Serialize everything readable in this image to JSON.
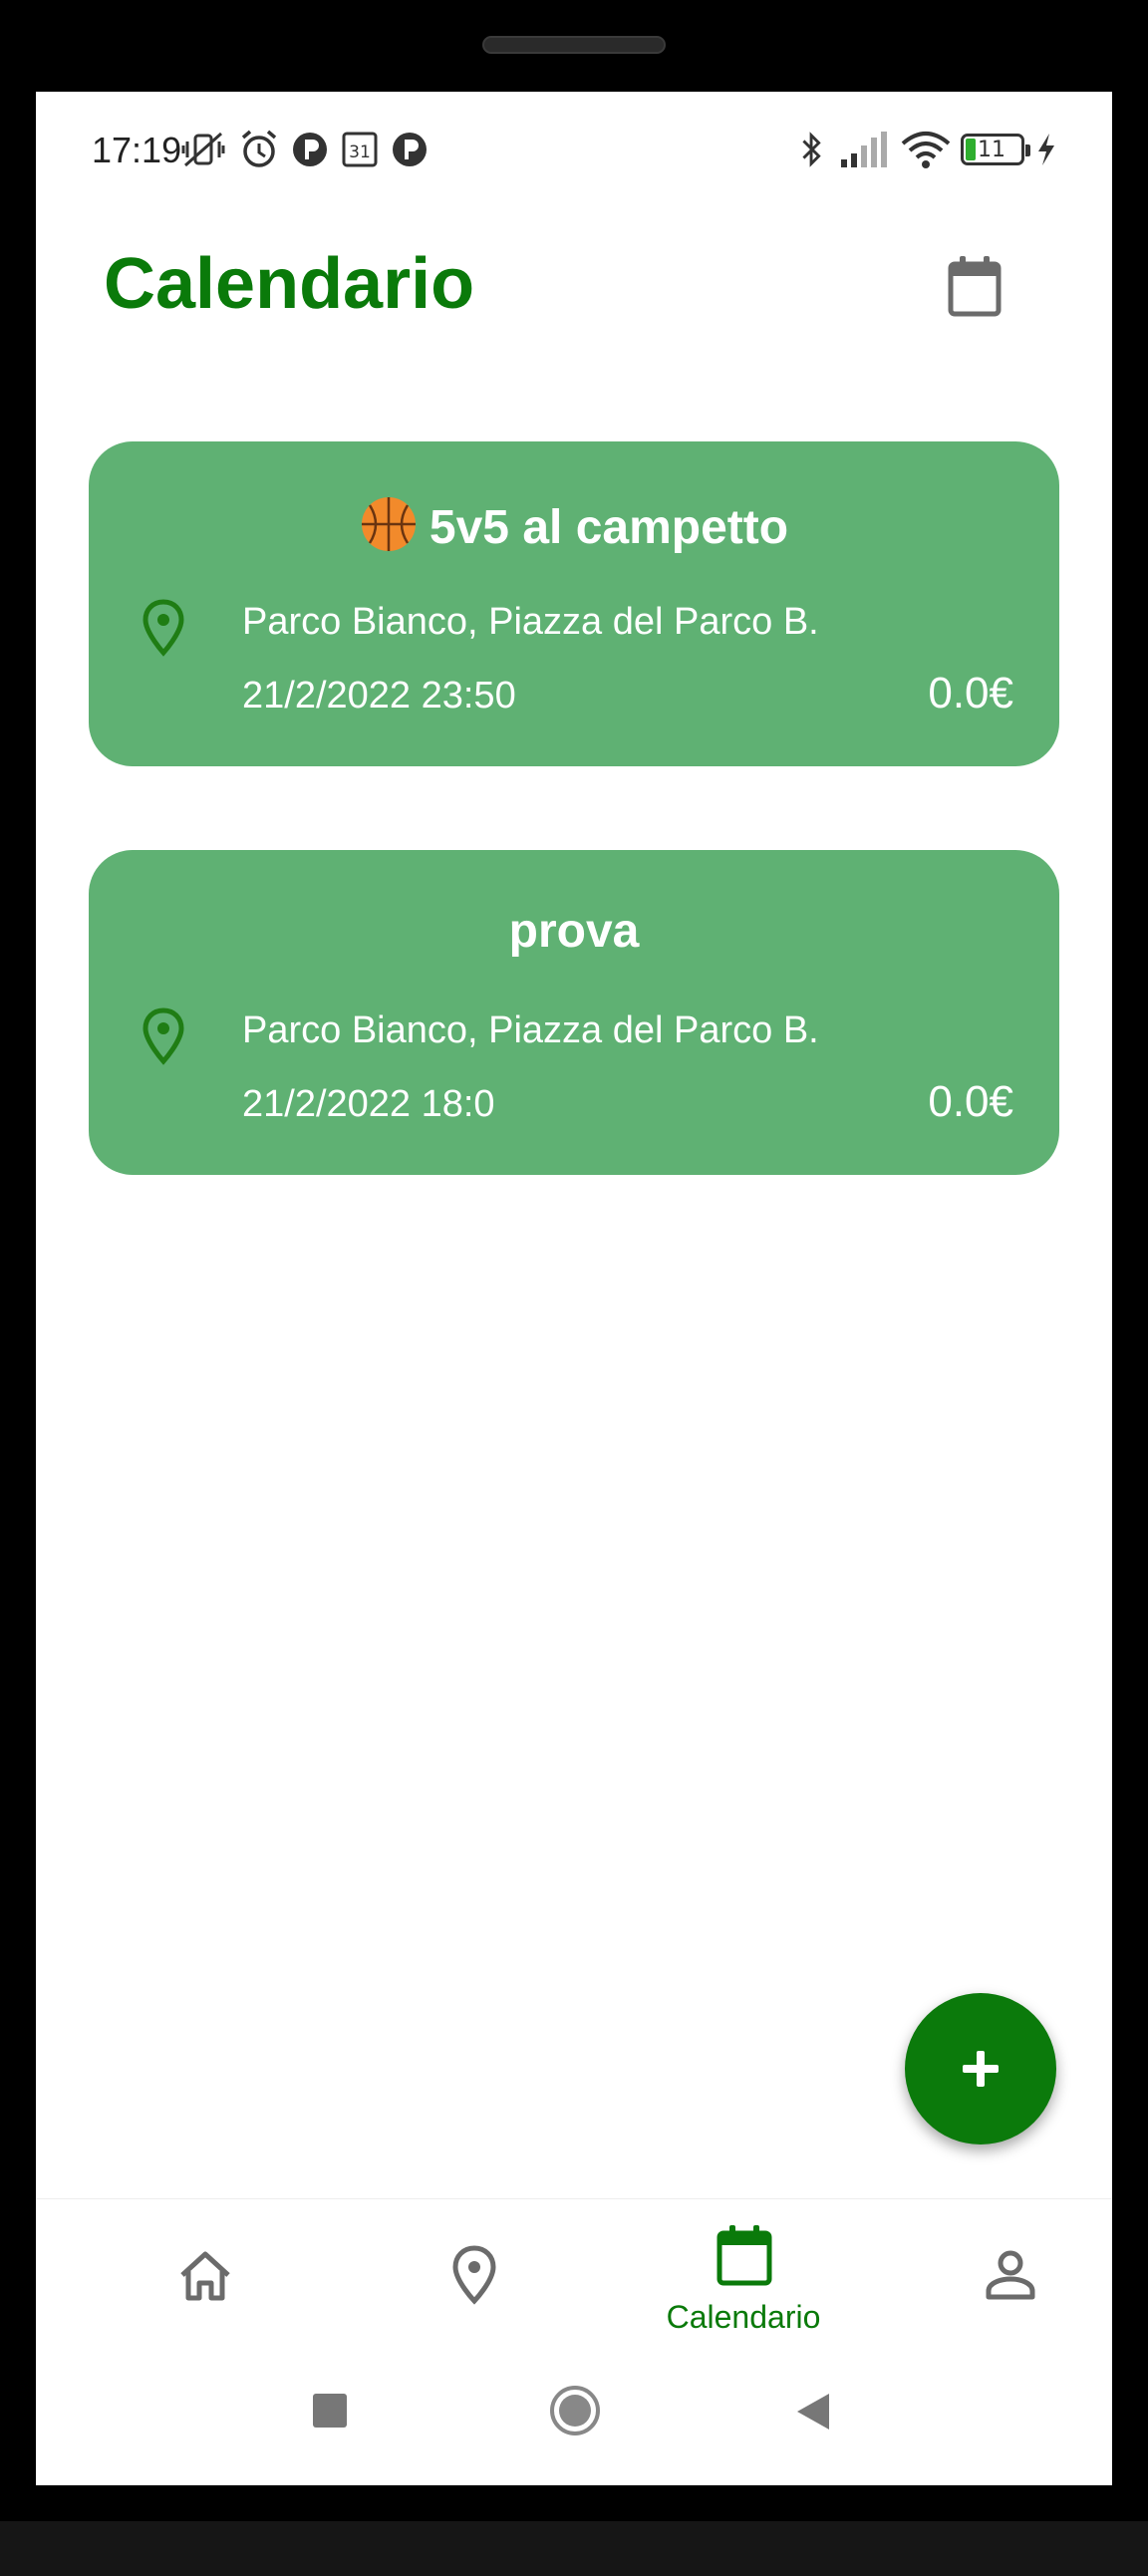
{
  "status_bar": {
    "time": "17:19",
    "battery": "11",
    "icons": [
      "mute-vibrate-icon",
      "alarm-icon",
      "app-notification-icon",
      "calendar-31-icon",
      "app-notification-icon",
      "bluetooth-icon",
      "signal-icon",
      "wifi-icon",
      "battery-icon",
      "charging-icon"
    ]
  },
  "header": {
    "title": "Calendario",
    "calendar_icon": "calendar-icon"
  },
  "events": [
    {
      "emoji": "basketball-icon",
      "title": "5v5 al campetto",
      "address": "Parco Bianco, Piazza del Parco B.",
      "datetime": "21/2/2022 23:50",
      "price": "0.0€"
    },
    {
      "emoji": "",
      "title": "prova",
      "address": "Parco Bianco, Piazza del Parco B.",
      "datetime": "21/2/2022 18:0",
      "price": "0.0€"
    }
  ],
  "fab": {
    "icon": "plus-icon"
  },
  "bottom_nav": {
    "items": [
      {
        "icon": "home-icon",
        "label": ""
      },
      {
        "icon": "map-pin-icon",
        "label": ""
      },
      {
        "icon": "calendar-icon",
        "label": "Calendario",
        "active": true
      },
      {
        "icon": "person-icon",
        "label": ""
      }
    ]
  },
  "colors": {
    "brand_green": "#0a7a0a",
    "card_green": "#5fb173",
    "fab_green": "#0b7a0b",
    "inactive_icon": "#6b6b6b"
  }
}
